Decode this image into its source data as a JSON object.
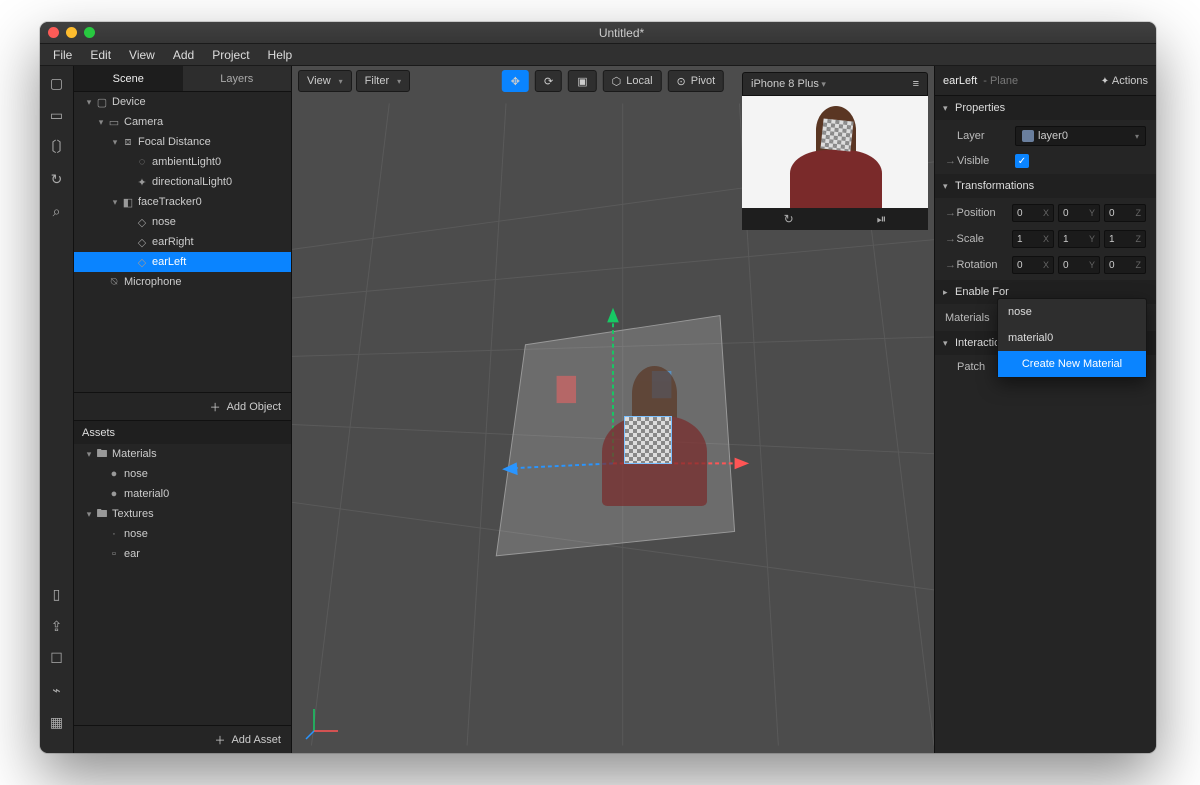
{
  "window": {
    "title": "Untitled*"
  },
  "menu": [
    "File",
    "Edit",
    "View",
    "Add",
    "Project",
    "Help"
  ],
  "iconbar_top": [
    "layout-icon",
    "video-icon",
    "code-icon",
    "refresh-icon",
    "search-icon"
  ],
  "iconbar_bottom": [
    "device-icon",
    "share-icon",
    "save-icon",
    "bug-icon",
    "grid-icon"
  ],
  "left_tabs": {
    "scene": "Scene",
    "layers": "Layers"
  },
  "scene_tree": [
    {
      "depth": 1,
      "chev": "open",
      "icon": "▢",
      "label": "Device"
    },
    {
      "depth": 2,
      "chev": "open",
      "icon": "▭",
      "label": "Camera"
    },
    {
      "depth": 3,
      "chev": "open",
      "icon": "⧈",
      "label": "Focal Distance"
    },
    {
      "depth": 4,
      "chev": "none",
      "icon": "◌",
      "label": "ambientLight0"
    },
    {
      "depth": 4,
      "chev": "none",
      "icon": "✦",
      "label": "directionalLight0"
    },
    {
      "depth": 3,
      "chev": "open",
      "icon": "◧",
      "label": "faceTracker0"
    },
    {
      "depth": 4,
      "chev": "none",
      "icon": "◇",
      "label": "nose"
    },
    {
      "depth": 4,
      "chev": "none",
      "icon": "◇",
      "label": "earRight"
    },
    {
      "depth": 4,
      "chev": "none",
      "icon": "◇",
      "label": "earLeft",
      "selected": true
    },
    {
      "depth": 2,
      "chev": "none",
      "icon": "⍉",
      "label": "Microphone"
    }
  ],
  "add_object": "Add Object",
  "assets_title": "Assets",
  "assets_tree": [
    {
      "depth": 1,
      "chev": "open",
      "icon": "🖿",
      "label": "Materials"
    },
    {
      "depth": 2,
      "chev": "none",
      "icon": "●",
      "label": "nose"
    },
    {
      "depth": 2,
      "chev": "none",
      "icon": "●",
      "label": "material0"
    },
    {
      "depth": 1,
      "chev": "open",
      "icon": "🖿",
      "label": "Textures"
    },
    {
      "depth": 2,
      "chev": "none",
      "icon": "·",
      "label": "nose"
    },
    {
      "depth": 2,
      "chev": "none",
      "icon": "▫",
      "label": "ear"
    }
  ],
  "add_asset": "Add Asset",
  "viewport": {
    "view_btn": "View",
    "filter_btn": "Filter",
    "local_btn": "Local",
    "pivot_btn": "Pivot"
  },
  "preview": {
    "device": "iPhone 8 Plus"
  },
  "inspector": {
    "name": "earLeft",
    "type": "- Plane",
    "actions": "Actions",
    "sections": {
      "properties": "Properties",
      "transformations": "Transformations",
      "enable_for": "Enable For",
      "materials": "Materials",
      "interactions": "Interactions"
    },
    "layer_label": "Layer",
    "layer_value": "layer0",
    "visible_label": "Visible",
    "position": {
      "label": "Position",
      "x": "0",
      "y": "0",
      "z": "0"
    },
    "scale": {
      "label": "Scale",
      "x": "1",
      "y": "1",
      "z": "1"
    },
    "rotation": {
      "label": "Rotation",
      "x": "0",
      "y": "0",
      "z": "0"
    },
    "patch_label": "Patch"
  },
  "material_popup": {
    "options": [
      "nose",
      "material0"
    ],
    "create": "Create New Material"
  }
}
